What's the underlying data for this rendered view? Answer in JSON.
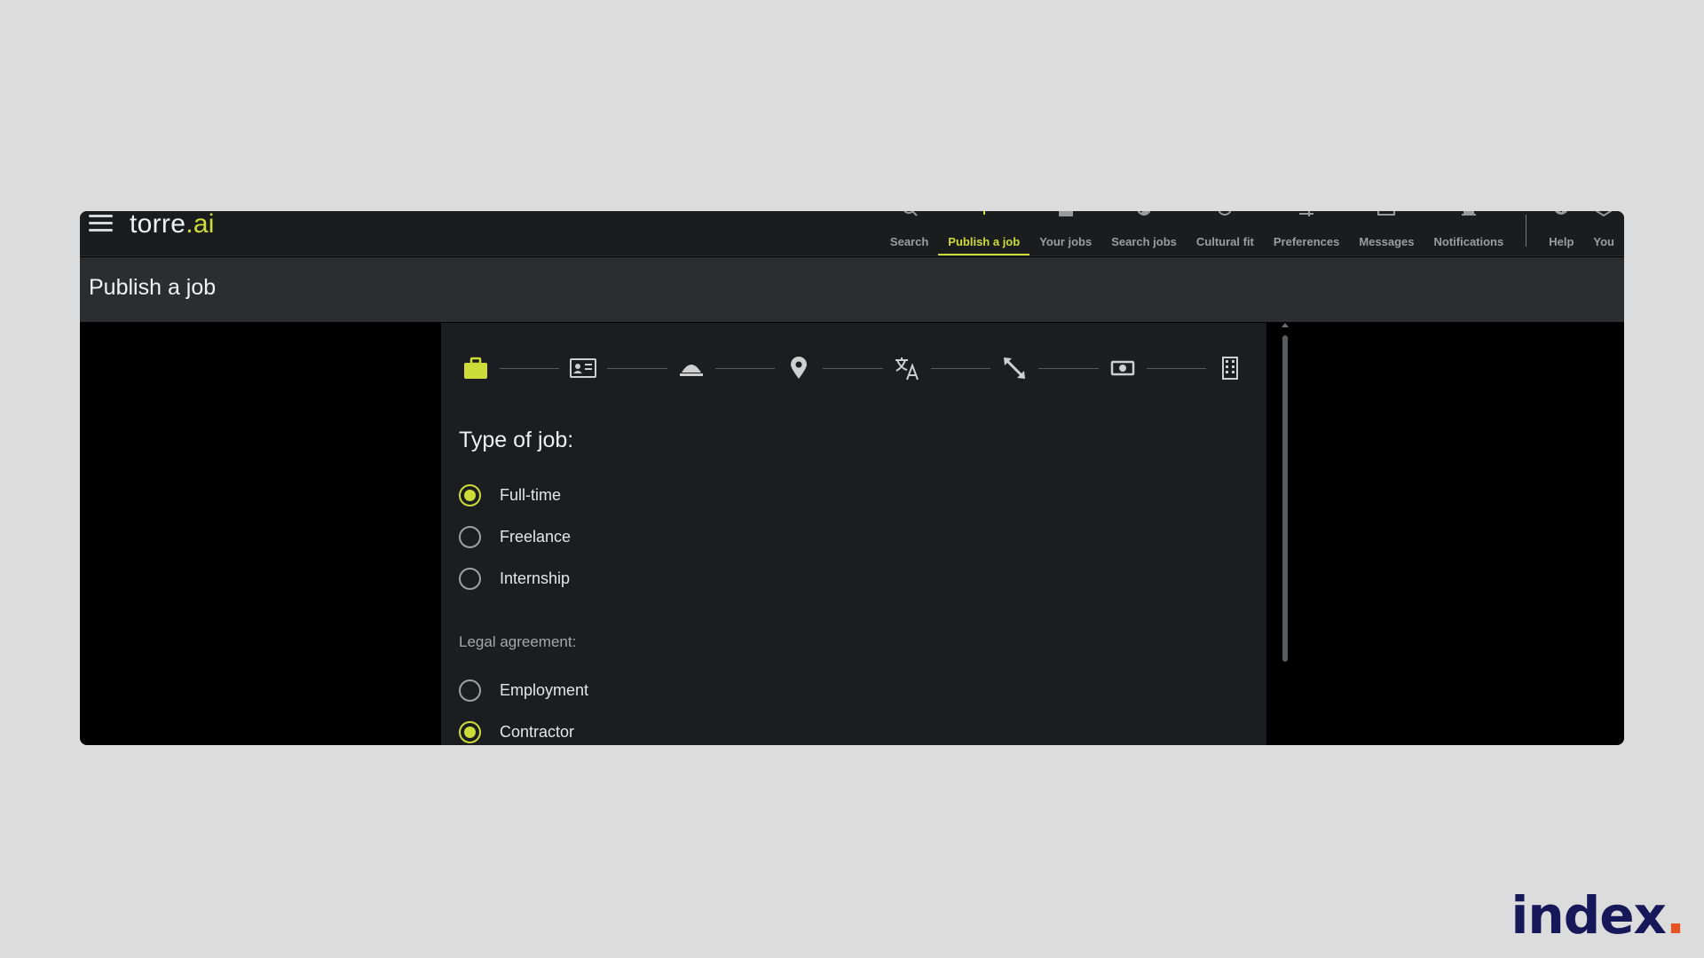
{
  "app": {
    "logo_main": "torre",
    "logo_accent": ".ai"
  },
  "nav": {
    "items": [
      {
        "label": "Search",
        "icon": "search-icon"
      },
      {
        "label": "Publish a job",
        "icon": "publish-icon",
        "active": true
      },
      {
        "label": "Your jobs",
        "icon": "briefcase-icon"
      },
      {
        "label": "Search jobs",
        "icon": "search-jobs-icon"
      },
      {
        "label": "Cultural fit",
        "icon": "cultural-fit-icon"
      },
      {
        "label": "Preferences",
        "icon": "preferences-icon"
      },
      {
        "label": "Messages",
        "icon": "messages-icon"
      },
      {
        "label": "Notifications",
        "icon": "bell-icon"
      },
      {
        "label": "Help",
        "icon": "help-icon"
      },
      {
        "label": "You",
        "icon": "user-icon"
      }
    ]
  },
  "page": {
    "title": "Publish a job"
  },
  "steps": [
    "briefcase-icon",
    "id-card-icon",
    "service-bell-icon",
    "location-pin-icon",
    "translate-icon",
    "resize-icon",
    "money-icon",
    "building-icon"
  ],
  "form": {
    "type_title": "Type of job:",
    "type_options": [
      {
        "label": "Full-time",
        "selected": true
      },
      {
        "label": "Freelance",
        "selected": false
      },
      {
        "label": "Internship",
        "selected": false
      }
    ],
    "legal_title": "Legal agreement:",
    "legal_options": [
      {
        "label": "Employment",
        "selected": false
      },
      {
        "label": "Contractor",
        "selected": true
      }
    ]
  },
  "brand": {
    "main": "index",
    "dot": "."
  },
  "colors": {
    "accent": "#cddc39",
    "brand": "#17185a",
    "brand_dot": "#e8541f"
  }
}
